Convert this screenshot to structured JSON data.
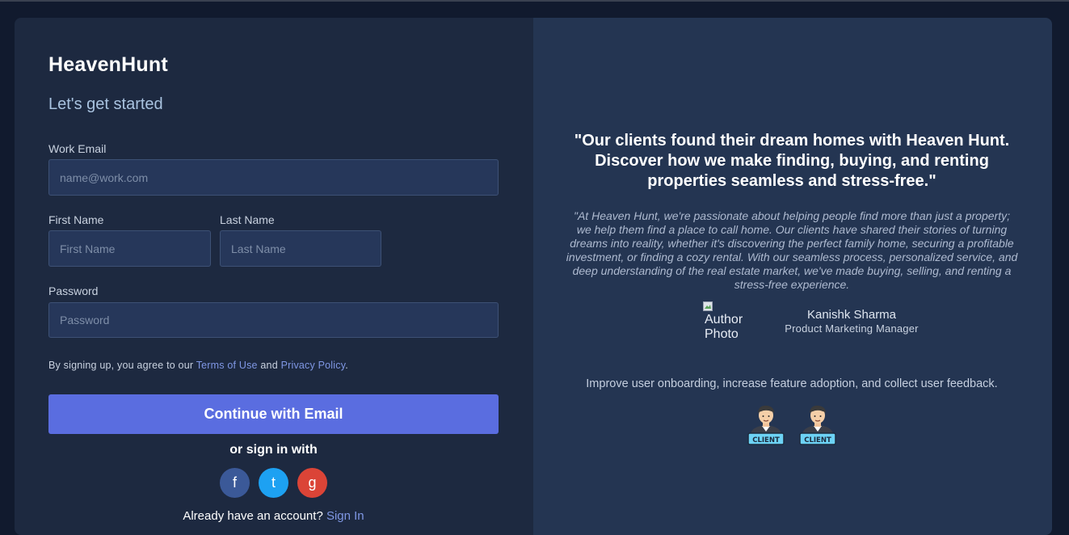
{
  "brand": "HeavenHunt",
  "subtitle": "Let's get started",
  "form": {
    "email_label": "Work Email",
    "email_placeholder": "name@work.com",
    "first_name_label": "First Name",
    "first_name_placeholder": "First Name",
    "last_name_label": "Last Name",
    "last_name_placeholder": "Last Name",
    "password_label": "Password",
    "password_placeholder": "Password"
  },
  "terms": {
    "prefix": "By signing up, you agree to our",
    "terms_link": "Terms of Use",
    "middle": "and",
    "privacy_link": "Privacy Policy",
    "suffix": "."
  },
  "continue_button": "Continue with Email",
  "or_sign_in": "or sign in with",
  "social": {
    "facebook": "f",
    "twitter": "t",
    "google": "g"
  },
  "already": {
    "text": "Already have an account?",
    "link": "Sign In"
  },
  "testimonial": {
    "quote": "\"Our clients found their dream homes with Heaven Hunt. Discover how we make finding, buying, and renting properties seamless and stress-free.\"",
    "body": "\"At Heaven Hunt, we're passionate about helping people find more than just a property; we help them find a place to call home. Our clients have shared their stories of turning dreams into reality, whether it's discovering the perfect family home, securing a profitable investment, or finding a cozy rental. With our seamless process, personalized service, and deep understanding of the real estate market, we've made buying, selling, and renting a stress-free experience.",
    "author_photo_alt": "Author Photo",
    "author_name": "Kanishk Sharma",
    "author_role": "Product Marketing Manager"
  },
  "tagline": "Improve user onboarding, increase feature adoption, and collect user feedback.",
  "client_badge": "CLIENT",
  "colors": {
    "accent": "#5a6de0",
    "facebook": "#3b5998",
    "twitter": "#1da1f2",
    "google": "#db4437",
    "left_panel": "#1d2940",
    "right_panel": "#243552"
  }
}
